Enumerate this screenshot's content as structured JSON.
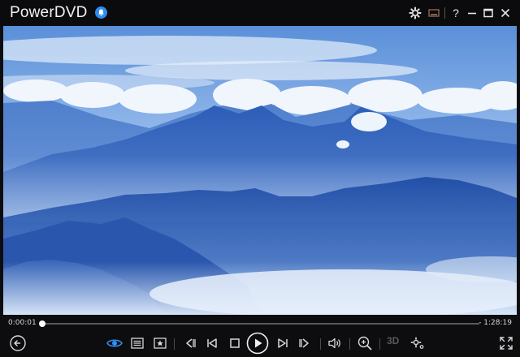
{
  "app": {
    "title": "PowerDVD"
  },
  "playback": {
    "elapsed": "0:00:01",
    "remaining": "- 1:28:19",
    "progress": 0.0
  },
  "controls": {
    "three_d_label": "3D"
  },
  "colors": {
    "accent": "#2f8df0",
    "background": "#0d0d0f",
    "text": "#e8e8e8"
  },
  "icons": {
    "titlebar": [
      "bell-icon",
      "settings-icon",
      "mini-player-icon",
      "help-icon",
      "minimize-icon",
      "maximize-icon",
      "close-icon"
    ],
    "controls": [
      "back-icon",
      "eye-icon",
      "playlist-icon",
      "bookmark-icon",
      "previous-chapter-icon",
      "skip-back-icon",
      "stop-icon",
      "play-icon",
      "skip-forward-icon",
      "next-chapter-icon",
      "volume-icon",
      "zoom-icon",
      "3d-icon",
      "settings-icon",
      "fullscreen-icon"
    ]
  }
}
